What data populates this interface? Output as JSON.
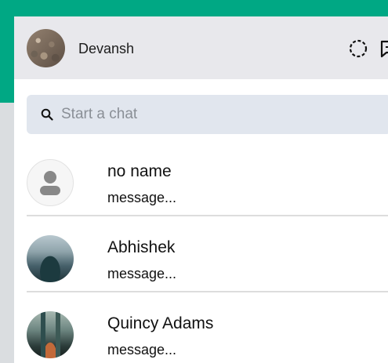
{
  "user": {
    "name": "Devansh"
  },
  "search": {
    "placeholder": "Start a chat"
  },
  "chats": [
    {
      "name": "no name",
      "preview": "message..."
    },
    {
      "name": "Abhishek",
      "preview": "message..."
    },
    {
      "name": "Quincy Adams",
      "preview": "message..."
    }
  ],
  "colors": {
    "brand": "#00a884",
    "header_bg": "#e8e8ec",
    "search_bg": "#e1e6ee",
    "backdrop": "#dadde0"
  }
}
